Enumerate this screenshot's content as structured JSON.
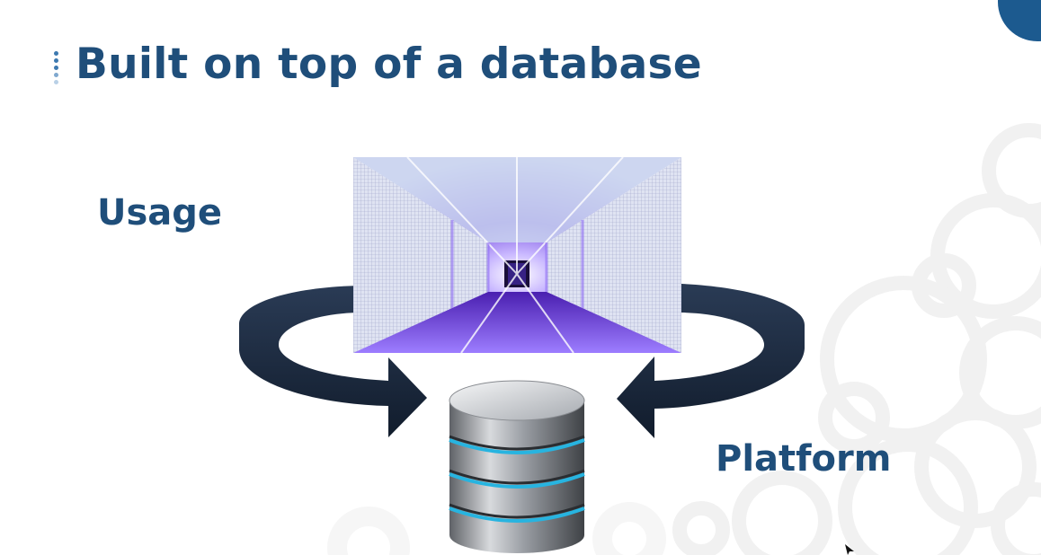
{
  "slide": {
    "title": "Built on top of a database",
    "labels": {
      "usage": "Usage",
      "platform": "Platform"
    }
  },
  "icons": {
    "title_bullet": "dotted-bullet-icon",
    "cycle": "circular-arrows-icon",
    "database": "database-cylinder-icon",
    "photo": "server-corridor-photo",
    "cursor": "mouse-cursor-icon"
  },
  "colors": {
    "title_text": "#1f4e7a",
    "accent_blue": "#1c5a8f",
    "arrow_navy": "#18263a",
    "database_ring": "#27b4e0"
  }
}
